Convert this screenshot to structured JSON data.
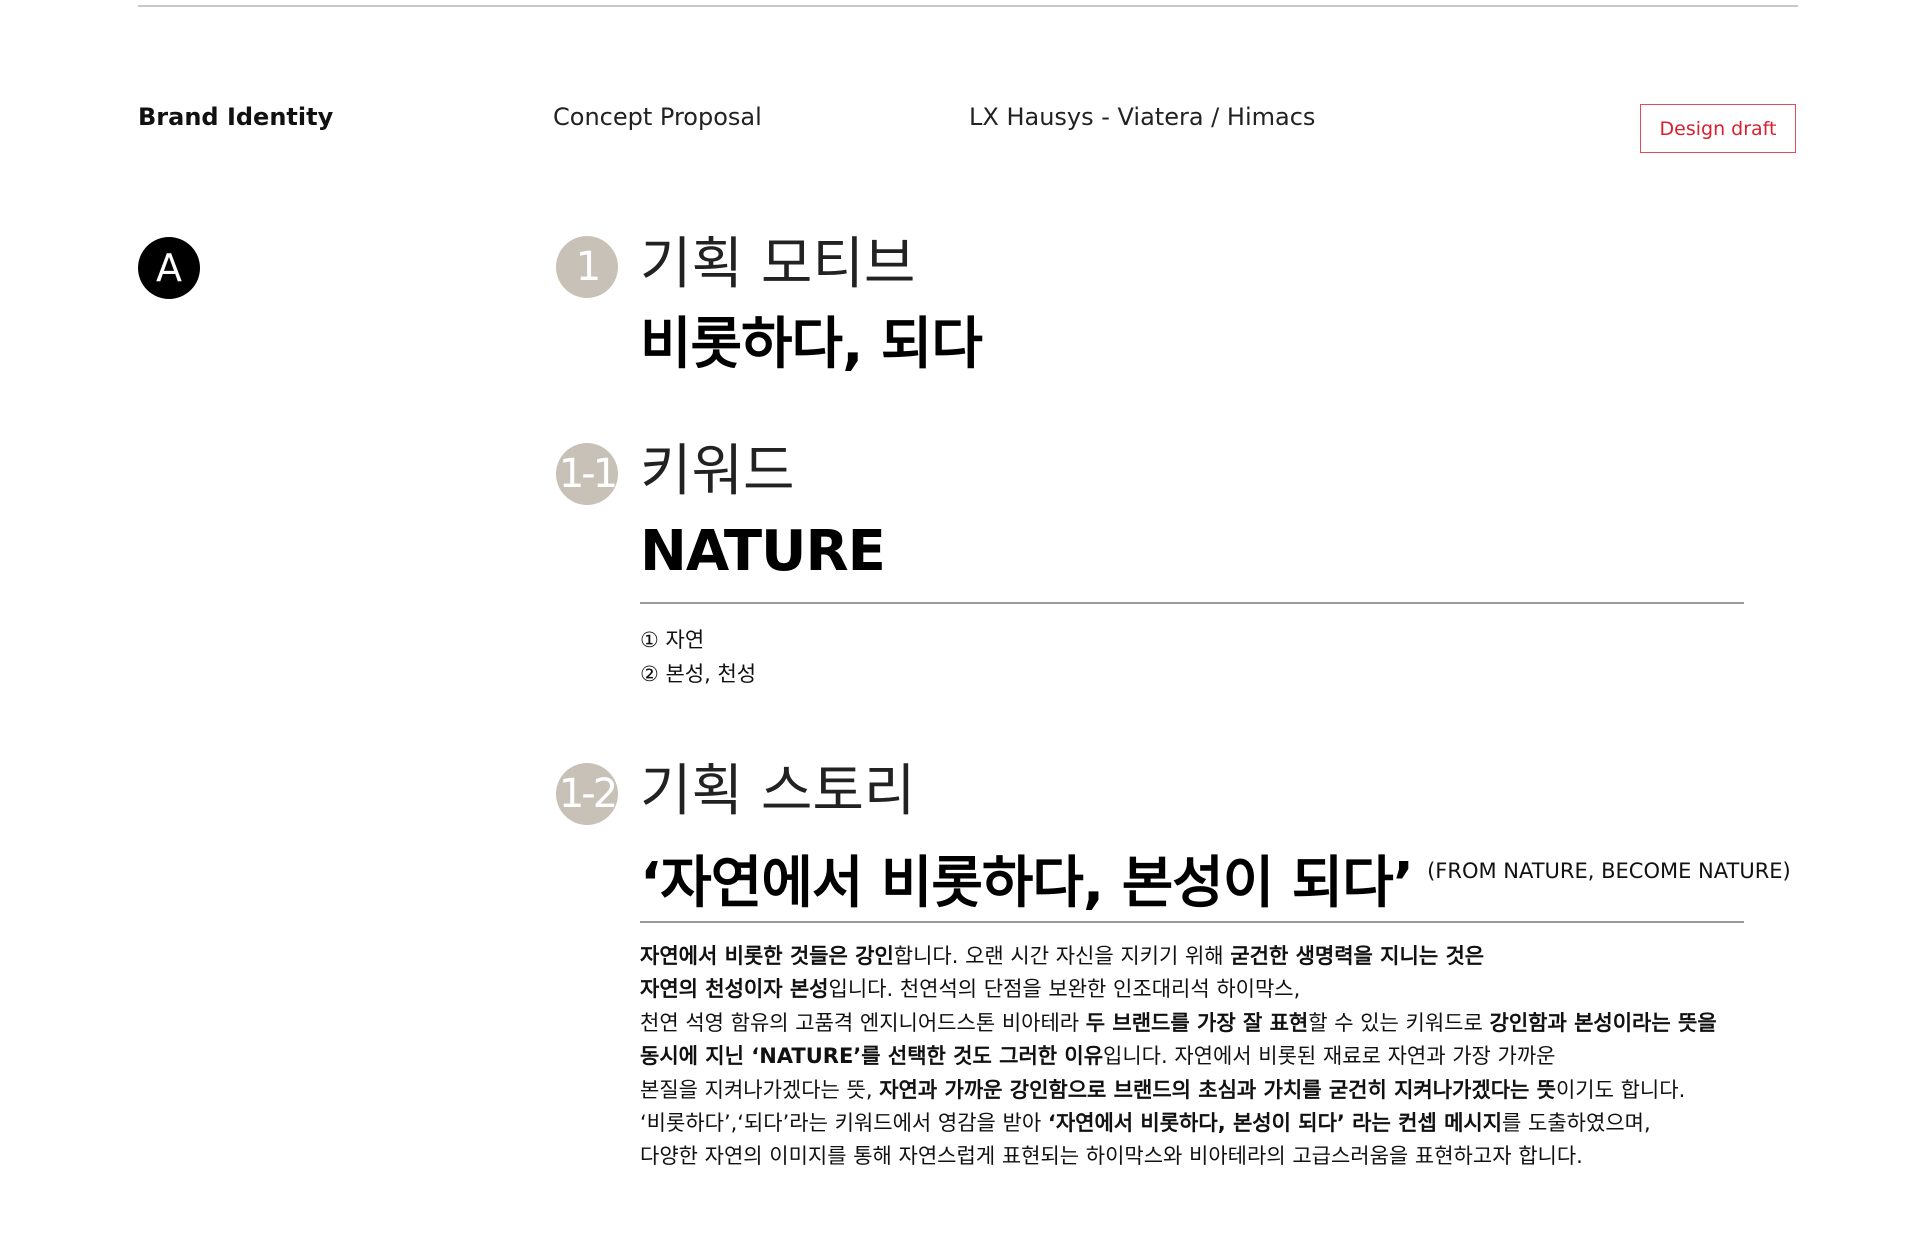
{
  "header": {
    "brand": "Brand Identity",
    "concept": "Concept Proposal",
    "client": "LX Hausys - Viatera / Himacs",
    "draft_badge": "Design draft"
  },
  "section_badge": "A",
  "sections": [
    {
      "number": "1",
      "title": "기획 모티브",
      "headline": "비롯하다, 되다"
    },
    {
      "number": "1-1",
      "title": "키워드",
      "headline": "NATURE",
      "definitions": [
        "① 자연",
        "② 본성, 천성"
      ]
    },
    {
      "number": "1-2",
      "title": "기획 스토리",
      "headline": "‘자연에서 비롯하다, 본성이 되다’",
      "headline_sub": "(FROM NATURE, BECOME NATURE)"
    }
  ],
  "story": {
    "l1a": "자연에서 비롯한 것들은 강인",
    "l1b": "합니다. 오랜 시간 자신을 지키기 위해 ",
    "l1c": "굳건한 생명력을 지니는 것은",
    "l2a": "자연의 천성이자 본성",
    "l2b": "입니다. 천연석의 단점을 보완한 인조대리석 하이막스,",
    "l3a": "천연 석영 함유의 고품격 엔지니어드스톤 비아테라 ",
    "l3b": "두 브랜드를 가장 잘 표현",
    "l3c": "할 수 있는 키워드로 ",
    "l3d": "강인함과 본성이라는 뜻을",
    "l4a": "동시에 지닌 ‘NATURE’를 선택한 것도 그러한 이유",
    "l4b": "입니다. 자연에서 비롯된 재료로 자연과 가장 가까운",
    "l5a": "본질을 지켜나가겠다는 뜻, ",
    "l5b": "자연과 가까운 강인함으로 브랜드의 초심과 가치를 굳건히 지켜나가겠다는 뜻",
    "l5c": "이기도 합니다.",
    "l6a": "‘비롯하다’,‘되다’라는 키워드에서 영감을 받아 ",
    "l6b": "‘자연에서 비롯하다, 본성이 되다’ 라는 컨셉 메시지",
    "l6c": "를 도출하였으며,",
    "l7a": "다양한 자연의 이미지를 통해 자연스럽게 표현되는 하이막스와 비아테라의 고급스러움을 표현하고자 합니다."
  },
  "colors": {
    "accent_red": "#d8202f",
    "number_circle": "#c8c1b8",
    "badge_black": "#000000"
  }
}
